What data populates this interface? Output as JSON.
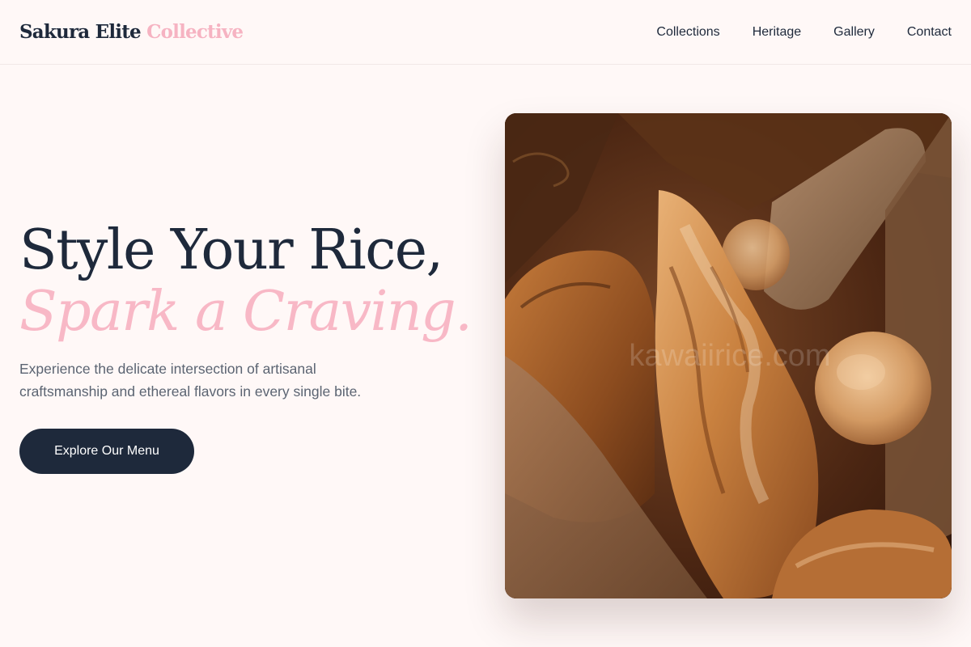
{
  "brand": {
    "name_part1": "Sakura Elite",
    "name_part2": "Collective"
  },
  "nav": {
    "items": [
      {
        "label": "Collections"
      },
      {
        "label": "Heritage"
      },
      {
        "label": "Gallery"
      },
      {
        "label": "Contact"
      }
    ]
  },
  "hero": {
    "title_line1": "Style Your Rice,",
    "title_line2": "Spark a Craving.",
    "description": "Experience the delicate intersection of artisanal craftsmanship and ethereal flavors in every single bite.",
    "cta_label": "Explore Our Menu"
  },
  "image": {
    "watermark": "kawaiirice.com"
  },
  "colors": {
    "background": "#fff8f7",
    "navy": "#1e293b",
    "pink_accent": "#f6b3c2",
    "body_text": "#5b6472"
  }
}
